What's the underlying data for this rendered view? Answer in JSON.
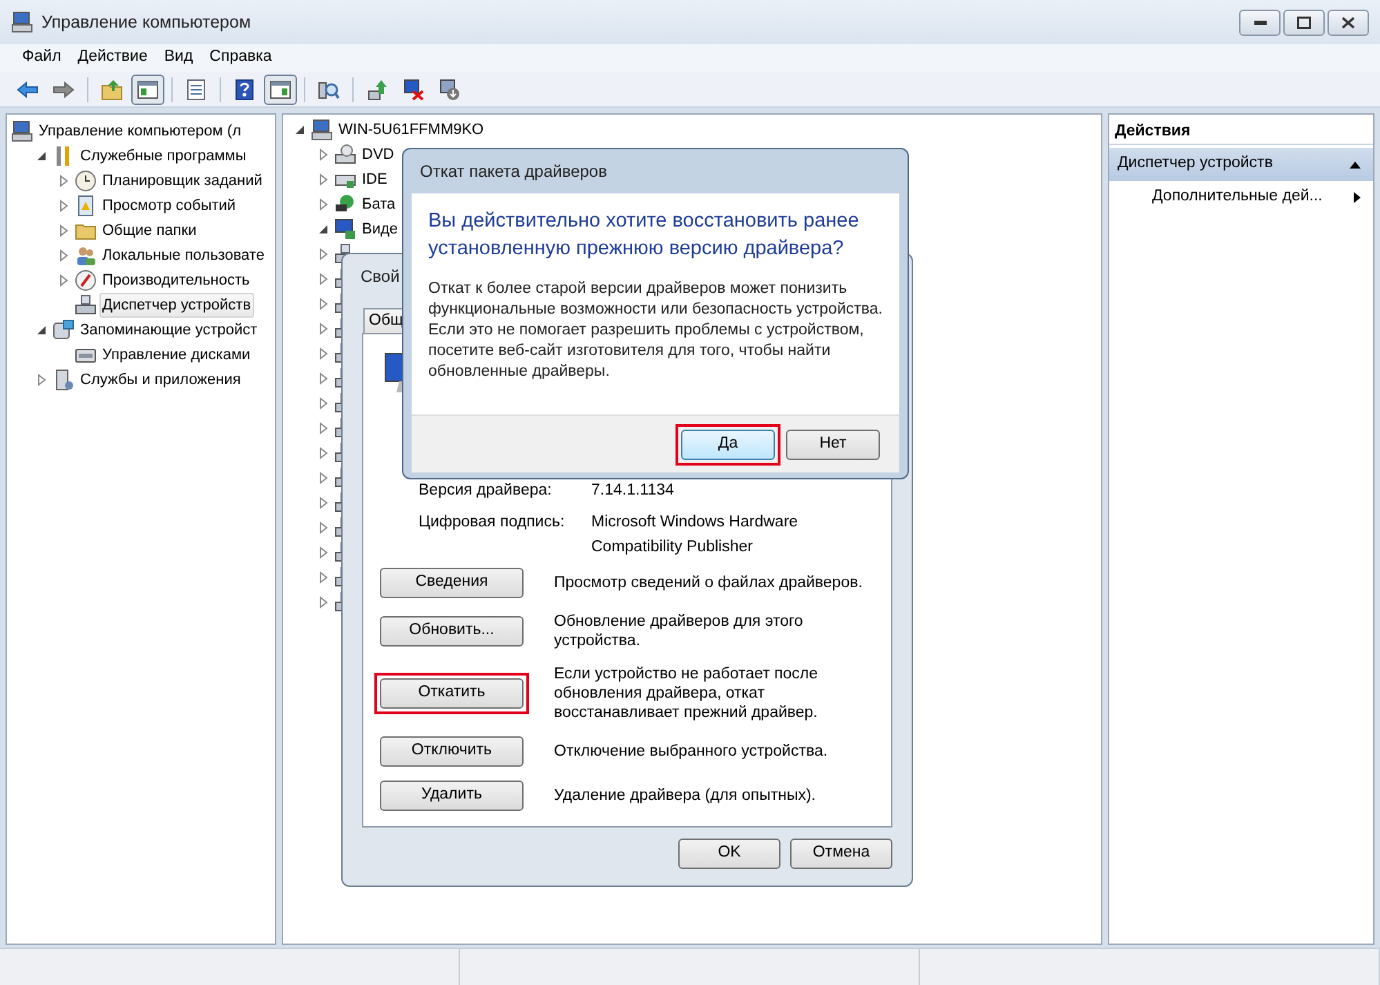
{
  "window": {
    "title": "Управление компьютером"
  },
  "window_controls": [
    {
      "kind": "minimize"
    },
    {
      "kind": "maximize"
    },
    {
      "kind": "close"
    }
  ],
  "menu": [
    "Файл",
    "Действие",
    "Вид",
    "Справка"
  ],
  "toolbar": [
    {
      "kind": "back",
      "pressed": false
    },
    {
      "kind": "forward",
      "pressed": false
    },
    {
      "kind": "separator"
    },
    {
      "kind": "up-folder",
      "pressed": false
    },
    {
      "kind": "tree-pane",
      "pressed": true
    },
    {
      "kind": "separator"
    },
    {
      "kind": "export",
      "pressed": false
    },
    {
      "kind": "separator"
    },
    {
      "kind": "help",
      "pressed": false
    },
    {
      "kind": "action-pane",
      "pressed": true
    },
    {
      "kind": "separator"
    },
    {
      "kind": "scan",
      "pressed": false
    },
    {
      "kind": "separator"
    },
    {
      "kind": "update",
      "pressed": false
    },
    {
      "kind": "disable",
      "pressed": false
    },
    {
      "kind": "uninstall",
      "pressed": false
    }
  ],
  "console_tree": [
    {
      "label": "Управление компьютером (л",
      "kind": "computer",
      "selected": false,
      "children": [
        {
          "label": "Служебные программы",
          "kind": "tools",
          "expanded": true,
          "selected": false,
          "children": [
            {
              "label": "Планировщик заданий",
              "kind": "clock",
              "expanded": false,
              "selected": false
            },
            {
              "label": "Просмотр событий",
              "kind": "log",
              "expanded": false,
              "selected": false
            },
            {
              "label": "Общие папки",
              "kind": "folder",
              "expanded": false,
              "selected": false
            },
            {
              "label": "Локальные пользовате",
              "kind": "users",
              "expanded": false,
              "selected": false
            },
            {
              "label": "Производительность",
              "kind": "gauge",
              "expanded": false,
              "selected": false
            },
            {
              "label": "Диспетчер устройств",
              "kind": "device",
              "selected": true
            }
          ]
        },
        {
          "label": "Запоминающие устройст",
          "kind": "storage",
          "expanded": true,
          "selected": false,
          "children": [
            {
              "label": "Управление дисками",
              "kind": "disk",
              "selected": false
            }
          ]
        },
        {
          "label": "Службы и приложения",
          "kind": "server",
          "expanded": false,
          "selected": false
        }
      ]
    }
  ],
  "device_tree": [
    {
      "label": "WIN-5U61FFMM9KO",
      "kind": "computer",
      "expanded": true,
      "children": [
        {
          "label": "DVD",
          "kind": "disc",
          "expanded": false
        },
        {
          "label": "IDE",
          "kind": "controller",
          "expanded": false
        },
        {
          "label": "Бата",
          "kind": "plug",
          "expanded": false
        },
        {
          "label": "Виде",
          "kind": "display",
          "expanded": true
        },
        {
          "kind": "device",
          "expanded": false
        },
        {
          "kind": "device",
          "expanded": false
        },
        {
          "kind": "device",
          "expanded": false
        },
        {
          "kind": "device",
          "expanded": false
        },
        {
          "kind": "device",
          "expanded": false
        },
        {
          "kind": "device",
          "expanded": false
        },
        {
          "kind": "device",
          "expanded": false
        },
        {
          "kind": "device",
          "expanded": false
        },
        {
          "kind": "device",
          "expanded": false
        },
        {
          "kind": "device",
          "expanded": false
        },
        {
          "kind": "device",
          "expanded": false
        },
        {
          "kind": "device",
          "expanded": false
        },
        {
          "kind": "device",
          "expanded": false
        },
        {
          "kind": "device",
          "expanded": false
        },
        {
          "kind": "device",
          "expanded": false
        }
      ]
    }
  ],
  "actions_pane": {
    "title": "Действия",
    "sections": [
      {
        "label": "Диспетчер устройств",
        "expanded": true,
        "items": [
          {
            "label": "Дополнительные дей...",
            "kind": "submenu"
          }
        ]
      }
    ]
  },
  "properties_dialog": {
    "title": "Свой",
    "tabs": [
      {
        "label": "Общ",
        "selected": false
      }
    ],
    "fields": [
      {
        "label": "Версия драйвера:",
        "value": "7.14.1.1134"
      },
      {
        "label": "Цифровая подпись:",
        "value": "Microsoft Windows Hardware Compatibility Publisher"
      }
    ],
    "actions": [
      {
        "button": "Сведения",
        "description": "Просмотр сведений о файлах драйверов.",
        "highlighted": false
      },
      {
        "button": "Обновить...",
        "description": "Обновление драйверов для этого устройства.",
        "highlighted": false
      },
      {
        "button": "Откатить",
        "description": "Если устройство не работает после обновления драйвера, откат восстанавливает прежний драйвер.",
        "highlighted": true
      },
      {
        "button": "Отключить",
        "description": "Отключение выбранного устройства.",
        "highlighted": false
      },
      {
        "button": "Удалить",
        "description": "Удаление драйвера (для опытных).",
        "highlighted": false
      }
    ],
    "buttons": [
      "OK",
      "Отмена"
    ]
  },
  "confirm_dialog": {
    "title": "Откат пакета драйверов",
    "heading": "Вы действительно хотите восстановить ранее установленную прежнюю версию драйвера?",
    "body": "Откат к более старой версии драйверов может понизить функциональные возможности или безопасность устройства. Если это не помогает разрешить проблемы с устройством, посетите веб-сайт изготовителя для того, чтобы найти обновленные драйверы.",
    "buttons": [
      {
        "label": "Да",
        "default": true,
        "highlighted": true
      },
      {
        "label": "Нет",
        "default": false,
        "highlighted": false
      }
    ]
  }
}
